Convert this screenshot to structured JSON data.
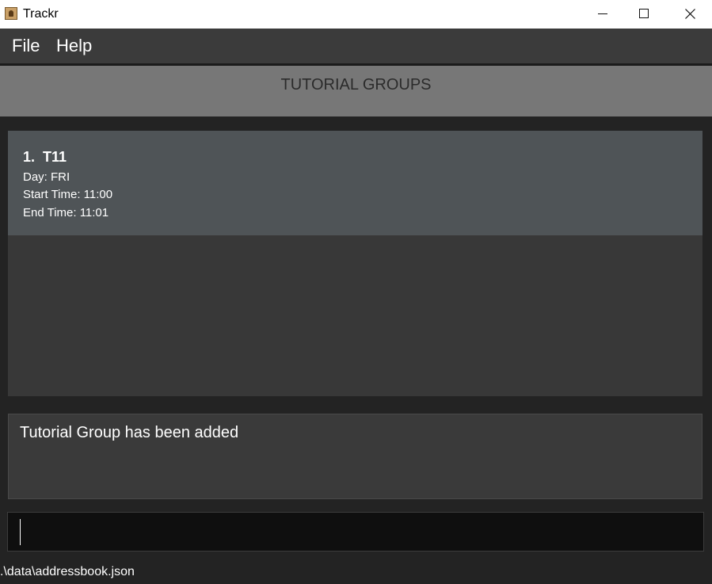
{
  "window": {
    "title": "Trackr",
    "app_icon": "trackr-app-icon",
    "controls": [
      "minimize-icon",
      "maximize-icon",
      "close-icon"
    ]
  },
  "menu": {
    "file_label": "File",
    "help_label": "Help"
  },
  "section": {
    "title": "TUTORIAL GROUPS"
  },
  "tutorial_groups": [
    {
      "index": "1.",
      "name": "T11",
      "day": "Day: FRI",
      "start_time": "Start Time: 11:00",
      "end_time": "End Time: 11:01"
    }
  ],
  "result": {
    "message": "Tutorial Group has been added"
  },
  "command": {
    "value": ""
  },
  "status": {
    "file_path": ".\\data\\addressbook.json"
  },
  "colors": {
    "menubar": "#3b3b3b",
    "header": "#777777",
    "card": "#4f5457",
    "panel": "#383838",
    "command_bg": "#0f0f0f"
  }
}
